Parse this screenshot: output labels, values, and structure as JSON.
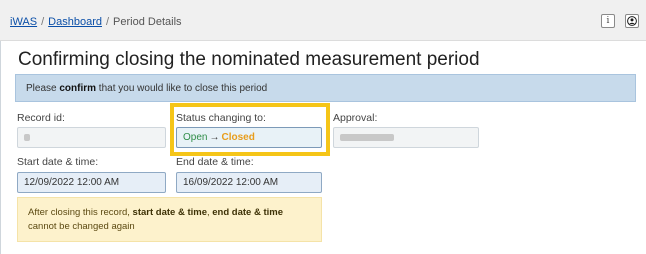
{
  "breadcrumb": {
    "app": "iWAS",
    "sep1": "/",
    "dashboard": "Dashboard",
    "sep2": "/",
    "current": "Period Details"
  },
  "header": {
    "info_icon": "info-icon",
    "user_icon": "user-circle-icon"
  },
  "page": {
    "title": "Confirming closing the nominated measurement period"
  },
  "notice": {
    "prefix": "Please ",
    "bold": "confirm",
    "suffix": " that you would like to close this period"
  },
  "form": {
    "record_id_label": "Record id:",
    "status_label": "Status changing to:",
    "status_from": "Open",
    "status_arrow": "→",
    "status_to": "Closed",
    "approval_label": "Approval:",
    "start_label": "Start date & time:",
    "start_value": "12/09/2022 12:00 AM",
    "end_label": "End date & time:",
    "end_value": "16/09/2022 12:00 AM"
  },
  "warning": {
    "t1": "After closing this record, ",
    "b1": "start date & time",
    "t2": ", ",
    "b2": "end date & time",
    "t3": " cannot be changed again"
  },
  "colors": {
    "highlight": "#f5c518",
    "open": "#2f8d48",
    "closed": "#e89d1b",
    "link": "#0b4fa8"
  }
}
